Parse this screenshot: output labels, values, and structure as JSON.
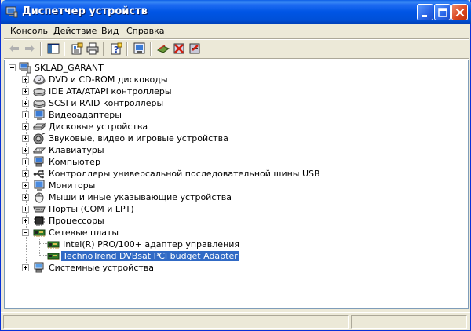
{
  "window": {
    "title": "Диспетчер устройств",
    "colors": {
      "titlebar": "#0055e5",
      "selection": "#316ac5",
      "close": "#d9431c"
    }
  },
  "titlebar_buttons": [
    "minimize-icon",
    "maximize-icon",
    "close-icon"
  ],
  "menu": [
    "Консоль",
    "Действие",
    "Вид",
    "Справка"
  ],
  "toolbar": {
    "buttons": [
      "back-arrow-icon",
      "forward-arrow-icon",
      "console-tree-icon",
      "properties-icon",
      "print-icon",
      "help-icon",
      "scan-hardware-icon",
      "update-driver-icon",
      "uninstall-icon",
      "disable-device-icon"
    ]
  },
  "tree": {
    "root": "SKLAD_GARANT",
    "categories": [
      {
        "label": "DVD и CD-ROM дисководы",
        "icon": "cdrom-icon",
        "expanded": false
      },
      {
        "label": "IDE ATA/ATAPI контроллеры",
        "icon": "ide-controller-icon",
        "expanded": false
      },
      {
        "label": "SCSI и RAID контроллеры",
        "icon": "scsi-controller-icon",
        "expanded": false
      },
      {
        "label": "Видеоадаптеры",
        "icon": "display-adapter-icon",
        "expanded": false
      },
      {
        "label": "Дисковые устройства",
        "icon": "disk-drive-icon",
        "expanded": false
      },
      {
        "label": "Звуковые, видео и игровые устройства",
        "icon": "sound-icon",
        "expanded": false
      },
      {
        "label": "Клавиатуры",
        "icon": "keyboard-icon",
        "expanded": false
      },
      {
        "label": "Компьютер",
        "icon": "computer-icon",
        "expanded": false
      },
      {
        "label": "Контроллеры универсальной последовательной шины USB",
        "icon": "usb-icon",
        "expanded": false
      },
      {
        "label": "Мониторы",
        "icon": "monitor-icon",
        "expanded": false
      },
      {
        "label": "Мыши и иные указывающие устройства",
        "icon": "mouse-icon",
        "expanded": false
      },
      {
        "label": "Порты (COM и LPT)",
        "icon": "port-icon",
        "expanded": false
      },
      {
        "label": "Процессоры",
        "icon": "processor-icon",
        "expanded": false
      },
      {
        "label": "Сетевые платы",
        "icon": "network-card-icon",
        "expanded": true,
        "children": [
          {
            "label": "Intel(R) PRO/100+ адаптер управления",
            "icon": "network-card-icon",
            "selected": false
          },
          {
            "label": "TechnoTrend DVBsat PCI budget Adapter",
            "icon": "network-card-icon",
            "selected": true
          }
        ]
      },
      {
        "label": "Системные устройства",
        "icon": "system-device-icon",
        "expanded": false
      }
    ]
  }
}
